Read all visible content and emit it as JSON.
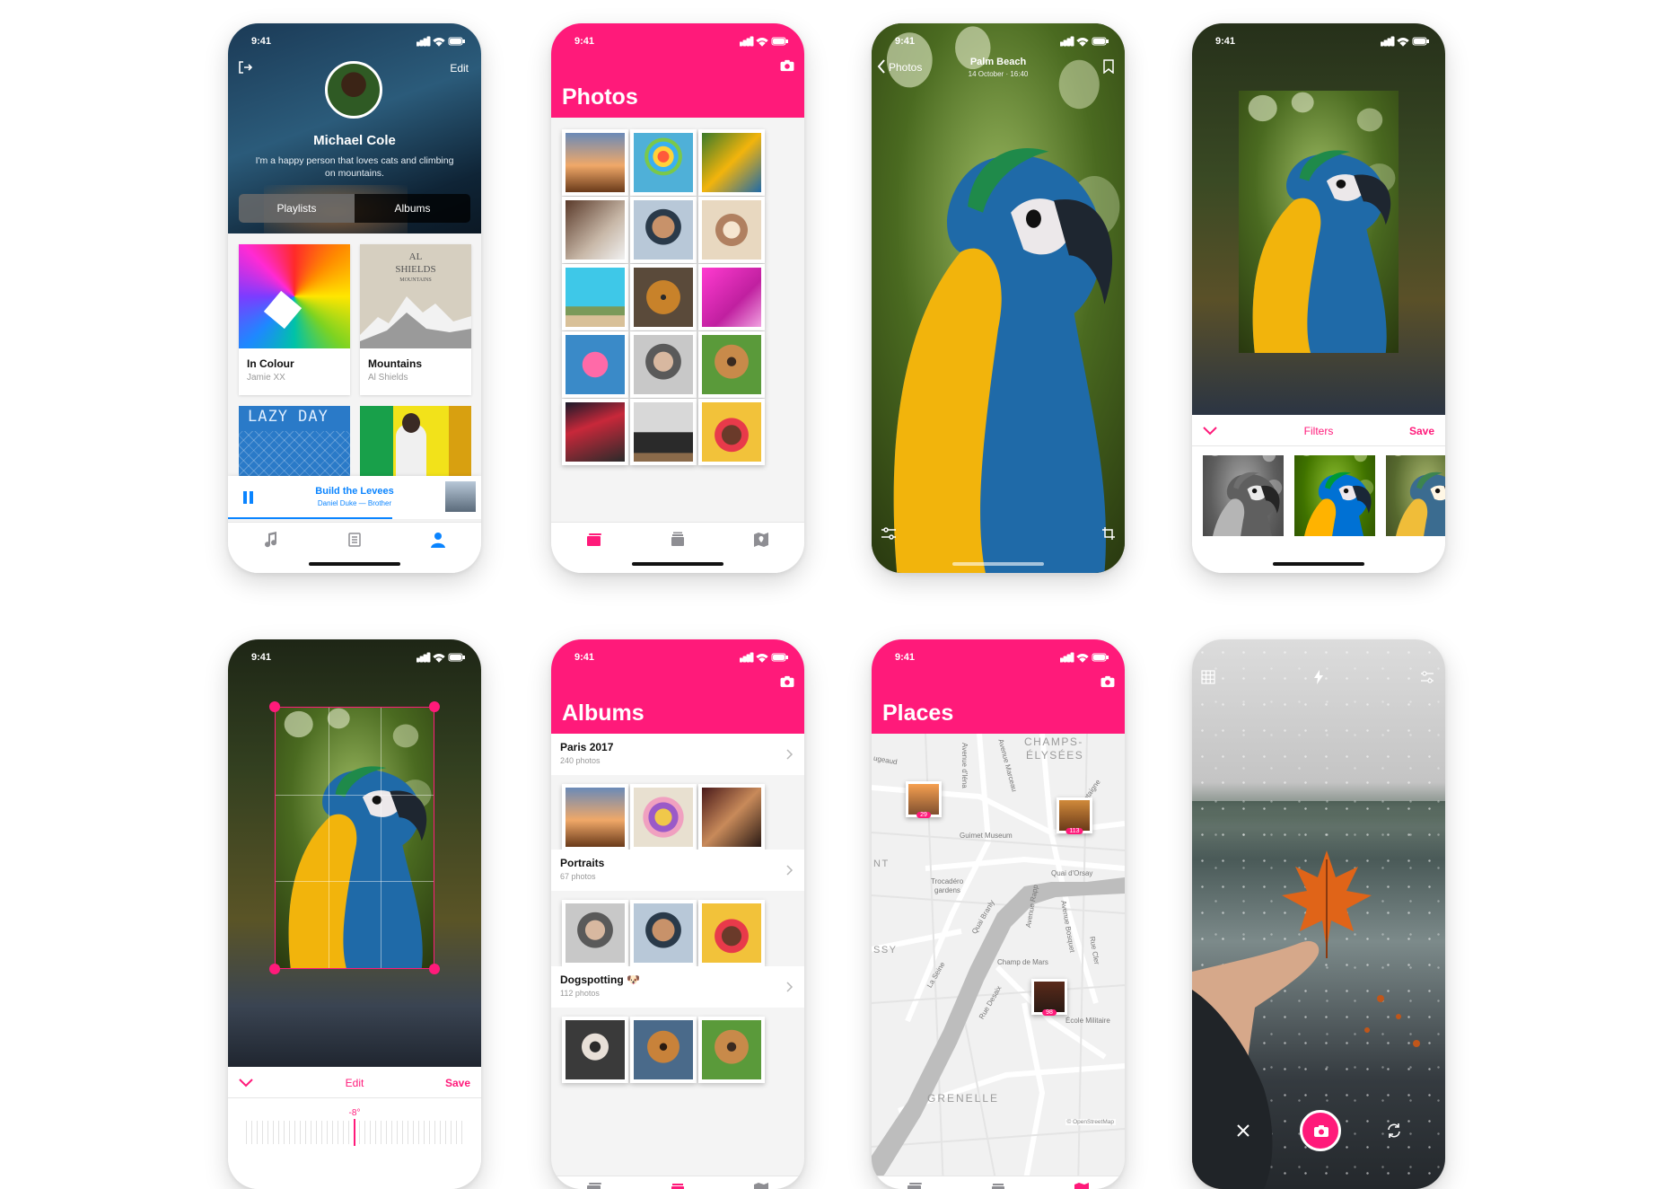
{
  "status_time": "9:41",
  "profile": {
    "edit_label": "Edit",
    "name": "Michael Cole",
    "bio_line1": "I'm a happy person that loves cats and climbing",
    "bio_line2": "on mountains.",
    "segments": [
      "Playlists",
      "Albums"
    ],
    "albums": [
      {
        "title": "In Colour",
        "artist": "Jamie XX"
      },
      {
        "title": "Mountains",
        "artist": "Al Shields"
      }
    ],
    "cover_text_al": "AL",
    "cover_text_shields": "SHIELDS",
    "cover_text_mountains": "MOUNTAINS",
    "cover_text_lazy": "LAZY DAY",
    "now_playing": {
      "title": "Build the Levees",
      "subtitle": "Daniel Duke — Brother",
      "progress": 0.65
    }
  },
  "photos_screen": {
    "title": "Photos"
  },
  "detail": {
    "back_label": "Photos",
    "place": "Palm Beach",
    "date": "14 October · 16:40"
  },
  "filters": {
    "title": "Filters",
    "save_label": "Save"
  },
  "crop": {
    "title": "Edit",
    "save_label": "Save",
    "angle": "-8°"
  },
  "albums_screen": {
    "title": "Albums",
    "groups": [
      {
        "name": "Paris 2017",
        "count": "240 photos"
      },
      {
        "name": "Portraits",
        "count": "67 photos"
      },
      {
        "name": "Dogspotting 🐶",
        "count": "112 photos"
      }
    ]
  },
  "places_screen": {
    "title": "Places",
    "map_labels": {
      "champs": "CHAMPS-",
      "elysees": "ÉLYSÉES",
      "grenelle": "GRENELLE",
      "nt": "NT",
      "ssy": "SSY",
      "ugeaud": "ugeaud",
      "guimet": "Guimet Museum",
      "trocadero1": "Trocadéro",
      "trocadero2": "gardens",
      "quai_orsay": "Quai d'Orsay",
      "quai_branly": "Quai Branly",
      "champ_de_mars": "Champ de Mars",
      "ecole": "École Militaire",
      "av_rapp": "Avenue Rapp",
      "av_bosquet": "Avenue Bosquet",
      "av_iena": "Avenue d'Iéna",
      "av_marceau": "Avenue Marceau",
      "montaigne": "Montaigne",
      "rue_cler": "Rue Cler",
      "rue_desaix": "Rue Desaix",
      "la_seine": "La Seine",
      "attribution": "© OpenStreetMap"
    },
    "pins": [
      "29",
      "113",
      "98"
    ]
  },
  "icons": [
    "signal-icon",
    "wifi-icon",
    "battery-icon",
    "logout-icon",
    "camera-icon",
    "back-chevron-icon",
    "bookmark-icon",
    "adjust-icon",
    "crop-icon",
    "chevron-down-icon",
    "chevron-right-icon",
    "music-icon",
    "library-icon",
    "profile-icon",
    "photos-tab-icon",
    "albums-tab-icon",
    "places-tab-icon",
    "grid-icon",
    "flash-icon",
    "close-icon",
    "shutter-icon",
    "switch-camera-icon",
    "pause-icon"
  ],
  "colors": {
    "accent": "#ff1a7a",
    "link_blue": "#0a84ff"
  }
}
